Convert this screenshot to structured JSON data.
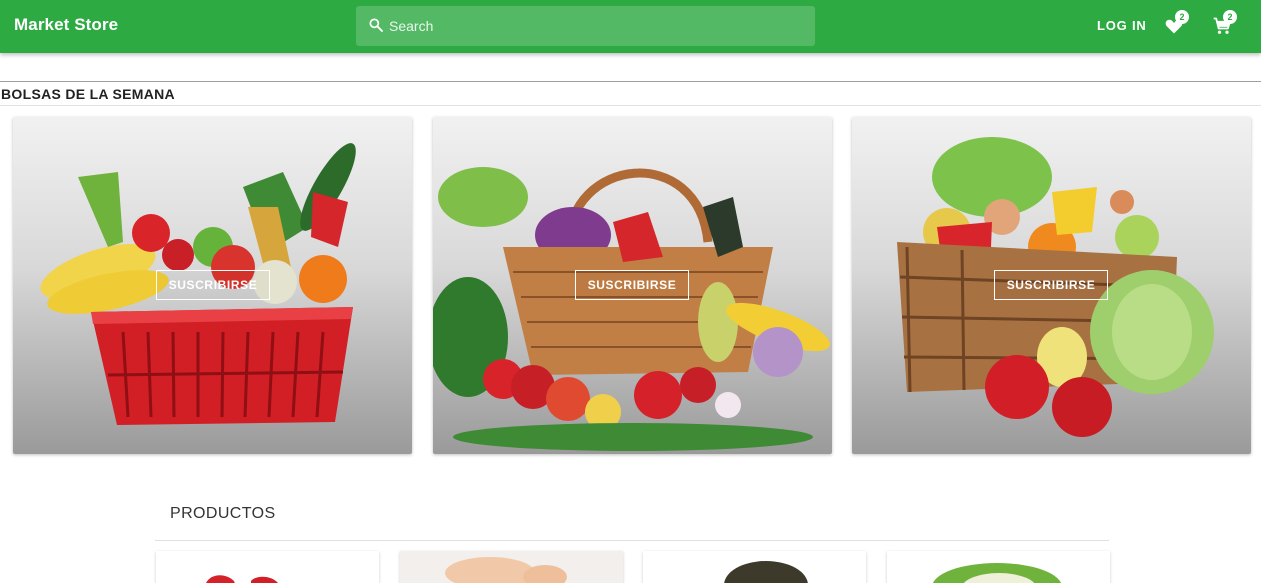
{
  "header": {
    "brand": "Market Store",
    "search_placeholder": "Search",
    "login_label": "LOG IN",
    "favorites_count": "2",
    "cart_count": "2",
    "icons": [
      "search-icon",
      "heart-tag-icon",
      "shopping-cart-icon"
    ],
    "accent_color": "#2eaa43"
  },
  "bags": {
    "title": "BOLSAS DE LA SEMANA",
    "cards": [
      {
        "image": "fruit-vegetable-red-basket",
        "button_label": "SUSCRIBIRSE"
      },
      {
        "image": "vegetable-wicker-basket",
        "button_label": "SUSCRIBIRSE"
      },
      {
        "image": "vegetable-wooden-crate",
        "button_label": "SUSCRIBIRSE"
      }
    ]
  },
  "products": {
    "title": "PRODUCTOS",
    "items": [
      {
        "image": "red-peppers"
      },
      {
        "image": "chicken"
      },
      {
        "image": "avocado"
      },
      {
        "image": "lettuce-cauliflower"
      }
    ]
  }
}
